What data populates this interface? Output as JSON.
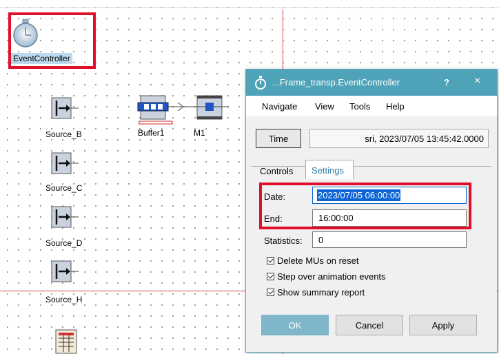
{
  "canvas": {
    "objects": {
      "event_controller": "EventController",
      "source_b": "Source_B",
      "source_c": "Source_C",
      "source_d": "Source_D",
      "source_h": "Source_H",
      "buffer1": "Buffer1",
      "m1": "M1"
    }
  },
  "dialog": {
    "title": "...Frame_transp.EventController",
    "help_glyph": "?",
    "close_glyph": "×",
    "menu": [
      "Navigate",
      "View",
      "Tools",
      "Help"
    ],
    "time_button": "Time",
    "time_value": "sri, 2023/07/05 13:45:42.0000",
    "tabs": [
      "Controls",
      "Settings"
    ],
    "active_tab": "Settings",
    "date_label": "Date:",
    "date_value": "2023/07/05 06:00:00",
    "end_label": "End:",
    "end_value": "16:00:00",
    "statistics_label": "Statistics:",
    "statistics_value": "0",
    "checkboxes": [
      {
        "label": "Delete MUs on reset",
        "checked": true
      },
      {
        "label": "Step over animation events",
        "checked": true
      },
      {
        "label": "Show summary report",
        "checked": true
      }
    ],
    "buttons": {
      "ok": "OK",
      "cancel": "Cancel",
      "apply": "Apply"
    }
  },
  "colors": {
    "highlight_red": "#e0102a",
    "titlebar": "#4ea3b8",
    "selection": "#0a64d6"
  }
}
